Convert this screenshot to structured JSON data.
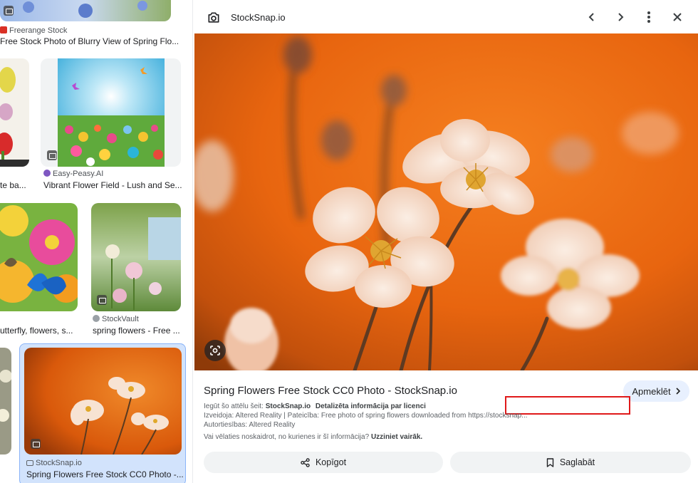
{
  "results": [
    {
      "source": "Freerange Stock",
      "title": "Free Stock Photo of Blurry View of Spring Flo..."
    },
    {
      "source": "",
      "title": "te ba..."
    },
    {
      "source": "Easy-Peasy.AI",
      "title": "Vibrant Flower Field - Lush and Se..."
    },
    {
      "source": "",
      "title": "utterfly, flowers, s..."
    },
    {
      "source": "StockVault",
      "title": "spring flowers - Free ..."
    },
    {
      "source": "StockSnap.io",
      "title": "Spring Flowers Free Stock CC0 Photo -..."
    }
  ],
  "panel": {
    "site_name": "StockSnap.io",
    "title": "Spring Flowers Free Stock CC0 Photo - StockSnap.io",
    "visit_label": "Apmeklēt",
    "source_prefix": "Iegūt šo attēlu šeit:",
    "source_site": "StockSnap.io",
    "license_link": "Detalizēta informācija par licenci",
    "creator_line": "Izveidoja: Altered Reality | Pateicība: Free photo of spring flowers downloaded from https://stocksnap...",
    "copyright_line": "Autortiesības: Altered Reality",
    "feedback_question": "Vai vēlaties noskaidrot, no kurienes ir šī informācija?",
    "feedback_link": "Uzziniet vairāk.",
    "share_label": "Kopīgot",
    "save_label": "Saglabāt"
  },
  "icons": {
    "site": "camera-icon",
    "prev": "chevron-left-icon",
    "next": "chevron-right-icon",
    "more": "more-vert-icon",
    "close": "close-icon",
    "lens": "lens-icon",
    "share": "share-icon",
    "save": "bookmark-icon"
  },
  "colors": {
    "highlight_box": "#e0191a",
    "visit_button": "#e8f0fe",
    "selected_result": "#d2e3fc",
    "photo_background": "#e8650f"
  }
}
